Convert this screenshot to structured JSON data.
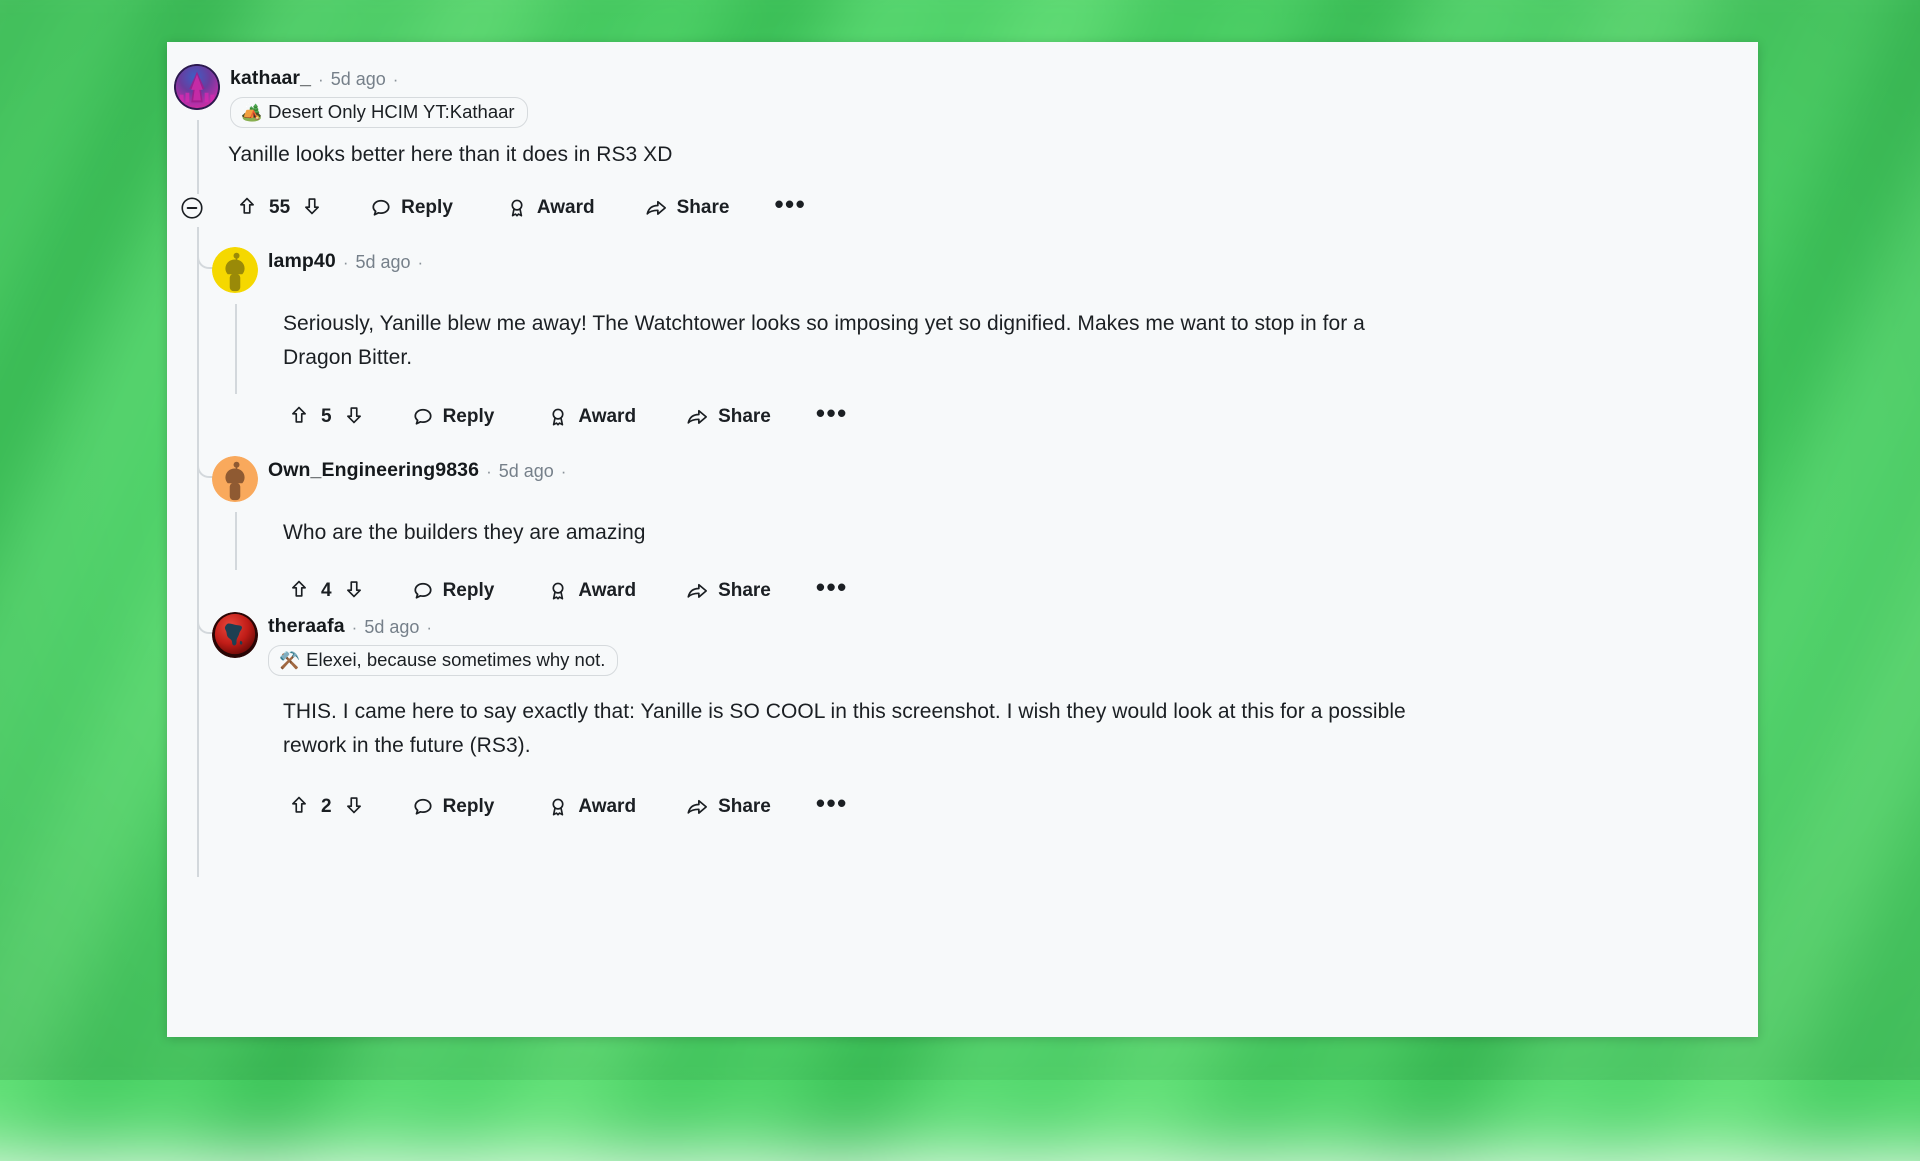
{
  "page": {
    "platform": "reddit-comment-thread",
    "background_color": "#4fd46a",
    "card_background": "#f7f9fa"
  },
  "labels": {
    "reply": "Reply",
    "award": "Award",
    "share": "Share",
    "more": "•••",
    "separator": "·"
  },
  "comments": [
    {
      "id": "c1",
      "username": "kathaar_",
      "timestamp": "5d ago",
      "flair": "Desert Only HCIM YT:Kathaar",
      "flair_emoji": "🏕️",
      "has_flair": true,
      "body": "Yanille looks better here than it does in RS3 XD",
      "score": "55",
      "depth": 0,
      "avatar_style": "purple-flame",
      "collapsible": true
    },
    {
      "id": "c2",
      "username": "lamp40",
      "timestamp": "5d ago",
      "flair": "",
      "flair_emoji": "",
      "has_flair": false,
      "body": "Seriously, Yanille blew me away! The Watchtower looks so imposing yet so dignified. Makes me want to stop in for a Dragon Bitter.",
      "score": "5",
      "depth": 1,
      "avatar_style": "yellow-snoo",
      "collapsible": false
    },
    {
      "id": "c3",
      "username": "Own_Engineering9836",
      "timestamp": "5d ago",
      "flair": "",
      "flair_emoji": "",
      "has_flair": false,
      "body": "Who are the builders they are amazing",
      "score": "4",
      "depth": 1,
      "avatar_style": "orange-snoo",
      "collapsible": false
    },
    {
      "id": "c4",
      "username": "theraafa",
      "timestamp": "5d ago",
      "flair": "Elexei, because sometimes why not.",
      "flair_emoji": "⚒️",
      "has_flair": true,
      "body": "THIS. I came here to say exactly that: Yanille is SO COOL in this screenshot. I wish they would look at this for a possible rework in the future (RS3).",
      "score": "2",
      "depth": 1,
      "avatar_style": "red-africa",
      "collapsible": false
    }
  ]
}
